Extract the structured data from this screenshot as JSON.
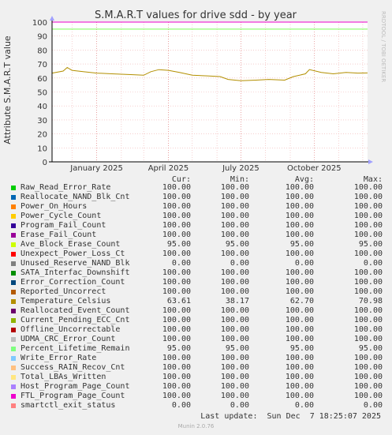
{
  "chart_data": {
    "type": "line",
    "title": "S.M.A.R.T values for drive sdd - by year",
    "ylabel": "Attribute S.M.A.R.T value",
    "ylim": [
      0,
      100
    ],
    "yticks": [
      0,
      10,
      20,
      30,
      40,
      50,
      60,
      70,
      80,
      90,
      100
    ],
    "xticks": [
      "January 2025",
      "April 2025",
      "July 2025",
      "October 2025"
    ],
    "side_label": "RRDTOOL / TOBI OETIKER",
    "x_range": [
      "2024-11-06",
      "2025-12-07"
    ],
    "grid": true,
    "series": [
      {
        "name": "Raw_Read_Error_Rate",
        "color": "#00cc00",
        "value": 100
      },
      {
        "name": "Reallocate_NAND_Blk_Cnt",
        "color": "#0066b3",
        "value": 100
      },
      {
        "name": "Power_On_Hours",
        "color": "#ff8000",
        "value": 100
      },
      {
        "name": "Power_Cycle_Count",
        "color": "#ffcc00",
        "value": 100
      },
      {
        "name": "Program_Fail_Count",
        "color": "#330099",
        "value": 100
      },
      {
        "name": "Erase_Fail_Count",
        "color": "#990099",
        "value": 100
      },
      {
        "name": "Ave_Block_Erase_Count",
        "color": "#ccff00",
        "value": 95
      },
      {
        "name": "Unexpect_Power_Loss_Ct",
        "color": "#ff0000",
        "value": 100
      },
      {
        "name": "Unused_Reserve_NAND_Blk",
        "color": "#808080",
        "value": 0
      },
      {
        "name": "SATA_Interfac_Downshift",
        "color": "#008f00",
        "value": 100
      },
      {
        "name": "Error_Correction_Count",
        "color": "#00487d",
        "value": 100
      },
      {
        "name": "Reported_Uncorrect",
        "color": "#b35a00",
        "value": 100
      },
      {
        "name": "Temperature_Celsius",
        "color": "#b38f00",
        "points": [
          [
            "2024-11-06",
            63.5
          ],
          [
            "2024-11-20",
            65.0
          ],
          [
            "2024-11-25",
            67.5
          ],
          [
            "2024-12-01",
            65.5
          ],
          [
            "2024-12-15",
            64.5
          ],
          [
            "2025-01-01",
            63.5
          ],
          [
            "2025-01-20",
            63.0
          ],
          [
            "2025-02-10",
            62.5
          ],
          [
            "2025-03-01",
            62.0
          ],
          [
            "2025-03-10",
            64.5
          ],
          [
            "2025-03-20",
            66.0
          ],
          [
            "2025-04-01",
            65.5
          ],
          [
            "2025-04-15",
            64.0
          ],
          [
            "2025-05-01",
            62.0
          ],
          [
            "2025-05-20",
            61.5
          ],
          [
            "2025-06-05",
            61.0
          ],
          [
            "2025-06-15",
            59.0
          ],
          [
            "2025-07-01",
            58.0
          ],
          [
            "2025-07-20",
            58.5
          ],
          [
            "2025-08-05",
            59.0
          ],
          [
            "2025-08-25",
            58.5
          ],
          [
            "2025-09-05",
            61.0
          ],
          [
            "2025-09-20",
            63.0
          ],
          [
            "2025-09-25",
            66.0
          ],
          [
            "2025-10-10",
            64.0
          ],
          [
            "2025-10-25",
            63.0
          ],
          [
            "2025-11-10",
            64.0
          ],
          [
            "2025-11-25",
            63.5
          ],
          [
            "2025-12-07",
            63.6
          ]
        ]
      },
      {
        "name": "Reallocated_Event_Count",
        "color": "#6b006b",
        "value": 100
      },
      {
        "name": "Current_Pending_ECC_Cnt",
        "color": "#8fb300",
        "value": 100
      },
      {
        "name": "Offline_Uncorrectable",
        "color": "#b30000",
        "value": 100
      },
      {
        "name": "UDMA_CRC_Error_Count",
        "color": "#bebebe",
        "value": 100
      },
      {
        "name": "Percent_Lifetime_Remain",
        "color": "#80ff80",
        "value": 95
      },
      {
        "name": "Write_Error_Rate",
        "color": "#80c9ff",
        "value": 100
      },
      {
        "name": "Success_RAIN_Recov_Cnt",
        "color": "#ffc080",
        "value": 100
      },
      {
        "name": "Total_LBAs_Written",
        "color": "#ffe680",
        "value": 100
      },
      {
        "name": "Host_Program_Page_Count",
        "color": "#aa80ff",
        "value": 100
      },
      {
        "name": "FTL_Program_Page_Count",
        "color": "#ee00cc",
        "value": 100
      },
      {
        "name": "smartctl_exit_status",
        "color": "#ff8080",
        "value": 0
      }
    ]
  },
  "legend": {
    "headers": {
      "cur": "Cur:",
      "min": "Min:",
      "avg": "Avg:",
      "max": "Max:"
    },
    "rows": [
      {
        "name": "Raw_Read_Error_Rate",
        "color": "#00cc00",
        "cur": "100.00",
        "min": "100.00",
        "avg": "100.00",
        "max": "100.00"
      },
      {
        "name": "Reallocate_NAND_Blk_Cnt",
        "color": "#0066b3",
        "cur": "100.00",
        "min": "100.00",
        "avg": "100.00",
        "max": "100.00"
      },
      {
        "name": "Power_On_Hours",
        "color": "#ff8000",
        "cur": "100.00",
        "min": "100.00",
        "avg": "100.00",
        "max": "100.00"
      },
      {
        "name": "Power_Cycle_Count",
        "color": "#ffcc00",
        "cur": "100.00",
        "min": "100.00",
        "avg": "100.00",
        "max": "100.00"
      },
      {
        "name": "Program_Fail_Count",
        "color": "#330099",
        "cur": "100.00",
        "min": "100.00",
        "avg": "100.00",
        "max": "100.00"
      },
      {
        "name": "Erase_Fail_Count",
        "color": "#990099",
        "cur": "100.00",
        "min": "100.00",
        "avg": "100.00",
        "max": "100.00"
      },
      {
        "name": "Ave_Block_Erase_Count",
        "color": "#ccff00",
        "cur": "95.00",
        "min": "95.00",
        "avg": "95.00",
        "max": "95.00"
      },
      {
        "name": "Unexpect_Power_Loss_Ct",
        "color": "#ff0000",
        "cur": "100.00",
        "min": "100.00",
        "avg": "100.00",
        "max": "100.00"
      },
      {
        "name": "Unused_Reserve_NAND_Blk",
        "color": "#808080",
        "cur": "0.00",
        "min": "0.00",
        "avg": "0.00",
        "max": "0.00"
      },
      {
        "name": "SATA_Interfac_Downshift",
        "color": "#008f00",
        "cur": "100.00",
        "min": "100.00",
        "avg": "100.00",
        "max": "100.00"
      },
      {
        "name": "Error_Correction_Count",
        "color": "#00487d",
        "cur": "100.00",
        "min": "100.00",
        "avg": "100.00",
        "max": "100.00"
      },
      {
        "name": "Reported_Uncorrect",
        "color": "#b35a00",
        "cur": "100.00",
        "min": "100.00",
        "avg": "100.00",
        "max": "100.00"
      },
      {
        "name": "Temperature_Celsius",
        "color": "#b38f00",
        "cur": "63.61",
        "min": "38.17",
        "avg": "62.70",
        "max": "70.98"
      },
      {
        "name": "Reallocated_Event_Count",
        "color": "#6b006b",
        "cur": "100.00",
        "min": "100.00",
        "avg": "100.00",
        "max": "100.00"
      },
      {
        "name": "Current_Pending_ECC_Cnt",
        "color": "#8fb300",
        "cur": "100.00",
        "min": "100.00",
        "avg": "100.00",
        "max": "100.00"
      },
      {
        "name": "Offline_Uncorrectable",
        "color": "#b30000",
        "cur": "100.00",
        "min": "100.00",
        "avg": "100.00",
        "max": "100.00"
      },
      {
        "name": "UDMA_CRC_Error_Count",
        "color": "#bebebe",
        "cur": "100.00",
        "min": "100.00",
        "avg": "100.00",
        "max": "100.00"
      },
      {
        "name": "Percent_Lifetime_Remain",
        "color": "#80ff80",
        "cur": "95.00",
        "min": "95.00",
        "avg": "95.00",
        "max": "95.00"
      },
      {
        "name": "Write_Error_Rate",
        "color": "#80c9ff",
        "cur": "100.00",
        "min": "100.00",
        "avg": "100.00",
        "max": "100.00"
      },
      {
        "name": "Success_RAIN_Recov_Cnt",
        "color": "#ffc080",
        "cur": "100.00",
        "min": "100.00",
        "avg": "100.00",
        "max": "100.00"
      },
      {
        "name": "Total_LBAs_Written",
        "color": "#ffe680",
        "cur": "100.00",
        "min": "100.00",
        "avg": "100.00",
        "max": "100.00"
      },
      {
        "name": "Host_Program_Page_Count",
        "color": "#aa80ff",
        "cur": "100.00",
        "min": "100.00",
        "avg": "100.00",
        "max": "100.00"
      },
      {
        "name": "FTL_Program_Page_Count",
        "color": "#ee00cc",
        "cur": "100.00",
        "min": "100.00",
        "avg": "100.00",
        "max": "100.00"
      },
      {
        "name": "smartctl_exit_status",
        "color": "#ff8080",
        "cur": "0.00",
        "min": "0.00",
        "avg": "0.00",
        "max": "0.00"
      }
    ]
  },
  "footer": {
    "last_update": "Last update:  Sun Dec  7 18:25:07 2025",
    "munin": "Munin 2.0.76"
  }
}
